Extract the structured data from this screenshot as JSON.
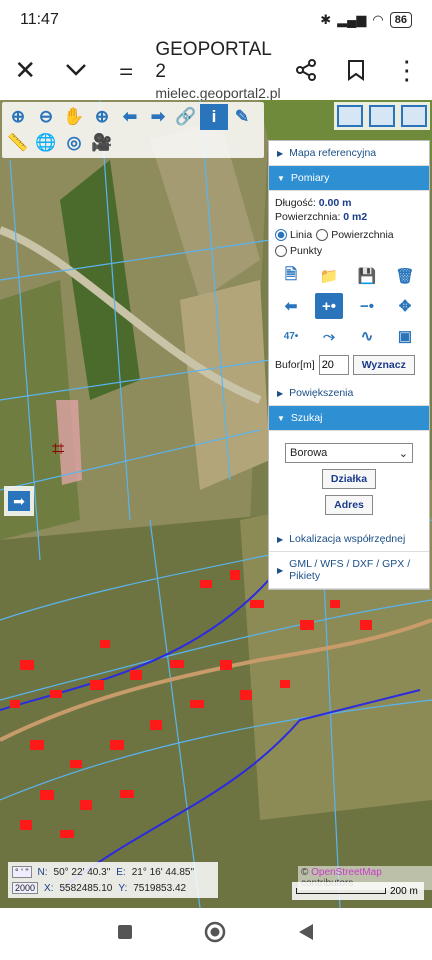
{
  "status": {
    "time": "11:47",
    "battery": "86"
  },
  "appbar": {
    "title": "GEOPORTAL 2",
    "url": "mielec.geoportal2.pl"
  },
  "panel": {
    "mapa": "Mapa referencyjna",
    "pomiary": "Pomiary",
    "dlugosc_label": "Długość:",
    "dlugosc_value": "0.00 m",
    "pow_label": "Powierzchnia:",
    "pow_value": "0 m2",
    "radio_linia": "Linia",
    "radio_pow": "Powierzchnia",
    "radio_punkty": "Punkty",
    "bufor_label": "Bufor[m]",
    "bufor_value": "20",
    "wyznacz": "Wyznacz",
    "powiekszenia": "Powiększenia",
    "szukaj": "Szukaj",
    "select_value": "Borowa",
    "dzialka": "Działka",
    "adres": "Adres",
    "lokalizacja": "Lokalizacja współrzędnej",
    "gml": "GML / WFS / DXF / GPX / Pikiety"
  },
  "coords": {
    "deg_box": "° ' \"",
    "n_label": "N:",
    "n_value": "50° 22' 40.3\"",
    "e_label": "E:",
    "e_value": "21° 16' 44.85\"",
    "epsg_box": "2000",
    "x_label": "X:",
    "x_value": "5582485.10",
    "y_label": "Y:",
    "y_value": "7519853.42"
  },
  "attribution": {
    "prefix": "©",
    "osm": "OpenStreetMap",
    "suffix": "contributors"
  },
  "scale": {
    "label": "200 m"
  },
  "colors": {
    "accent": "#2a74bb",
    "panel_header": "#2e8fd3"
  }
}
